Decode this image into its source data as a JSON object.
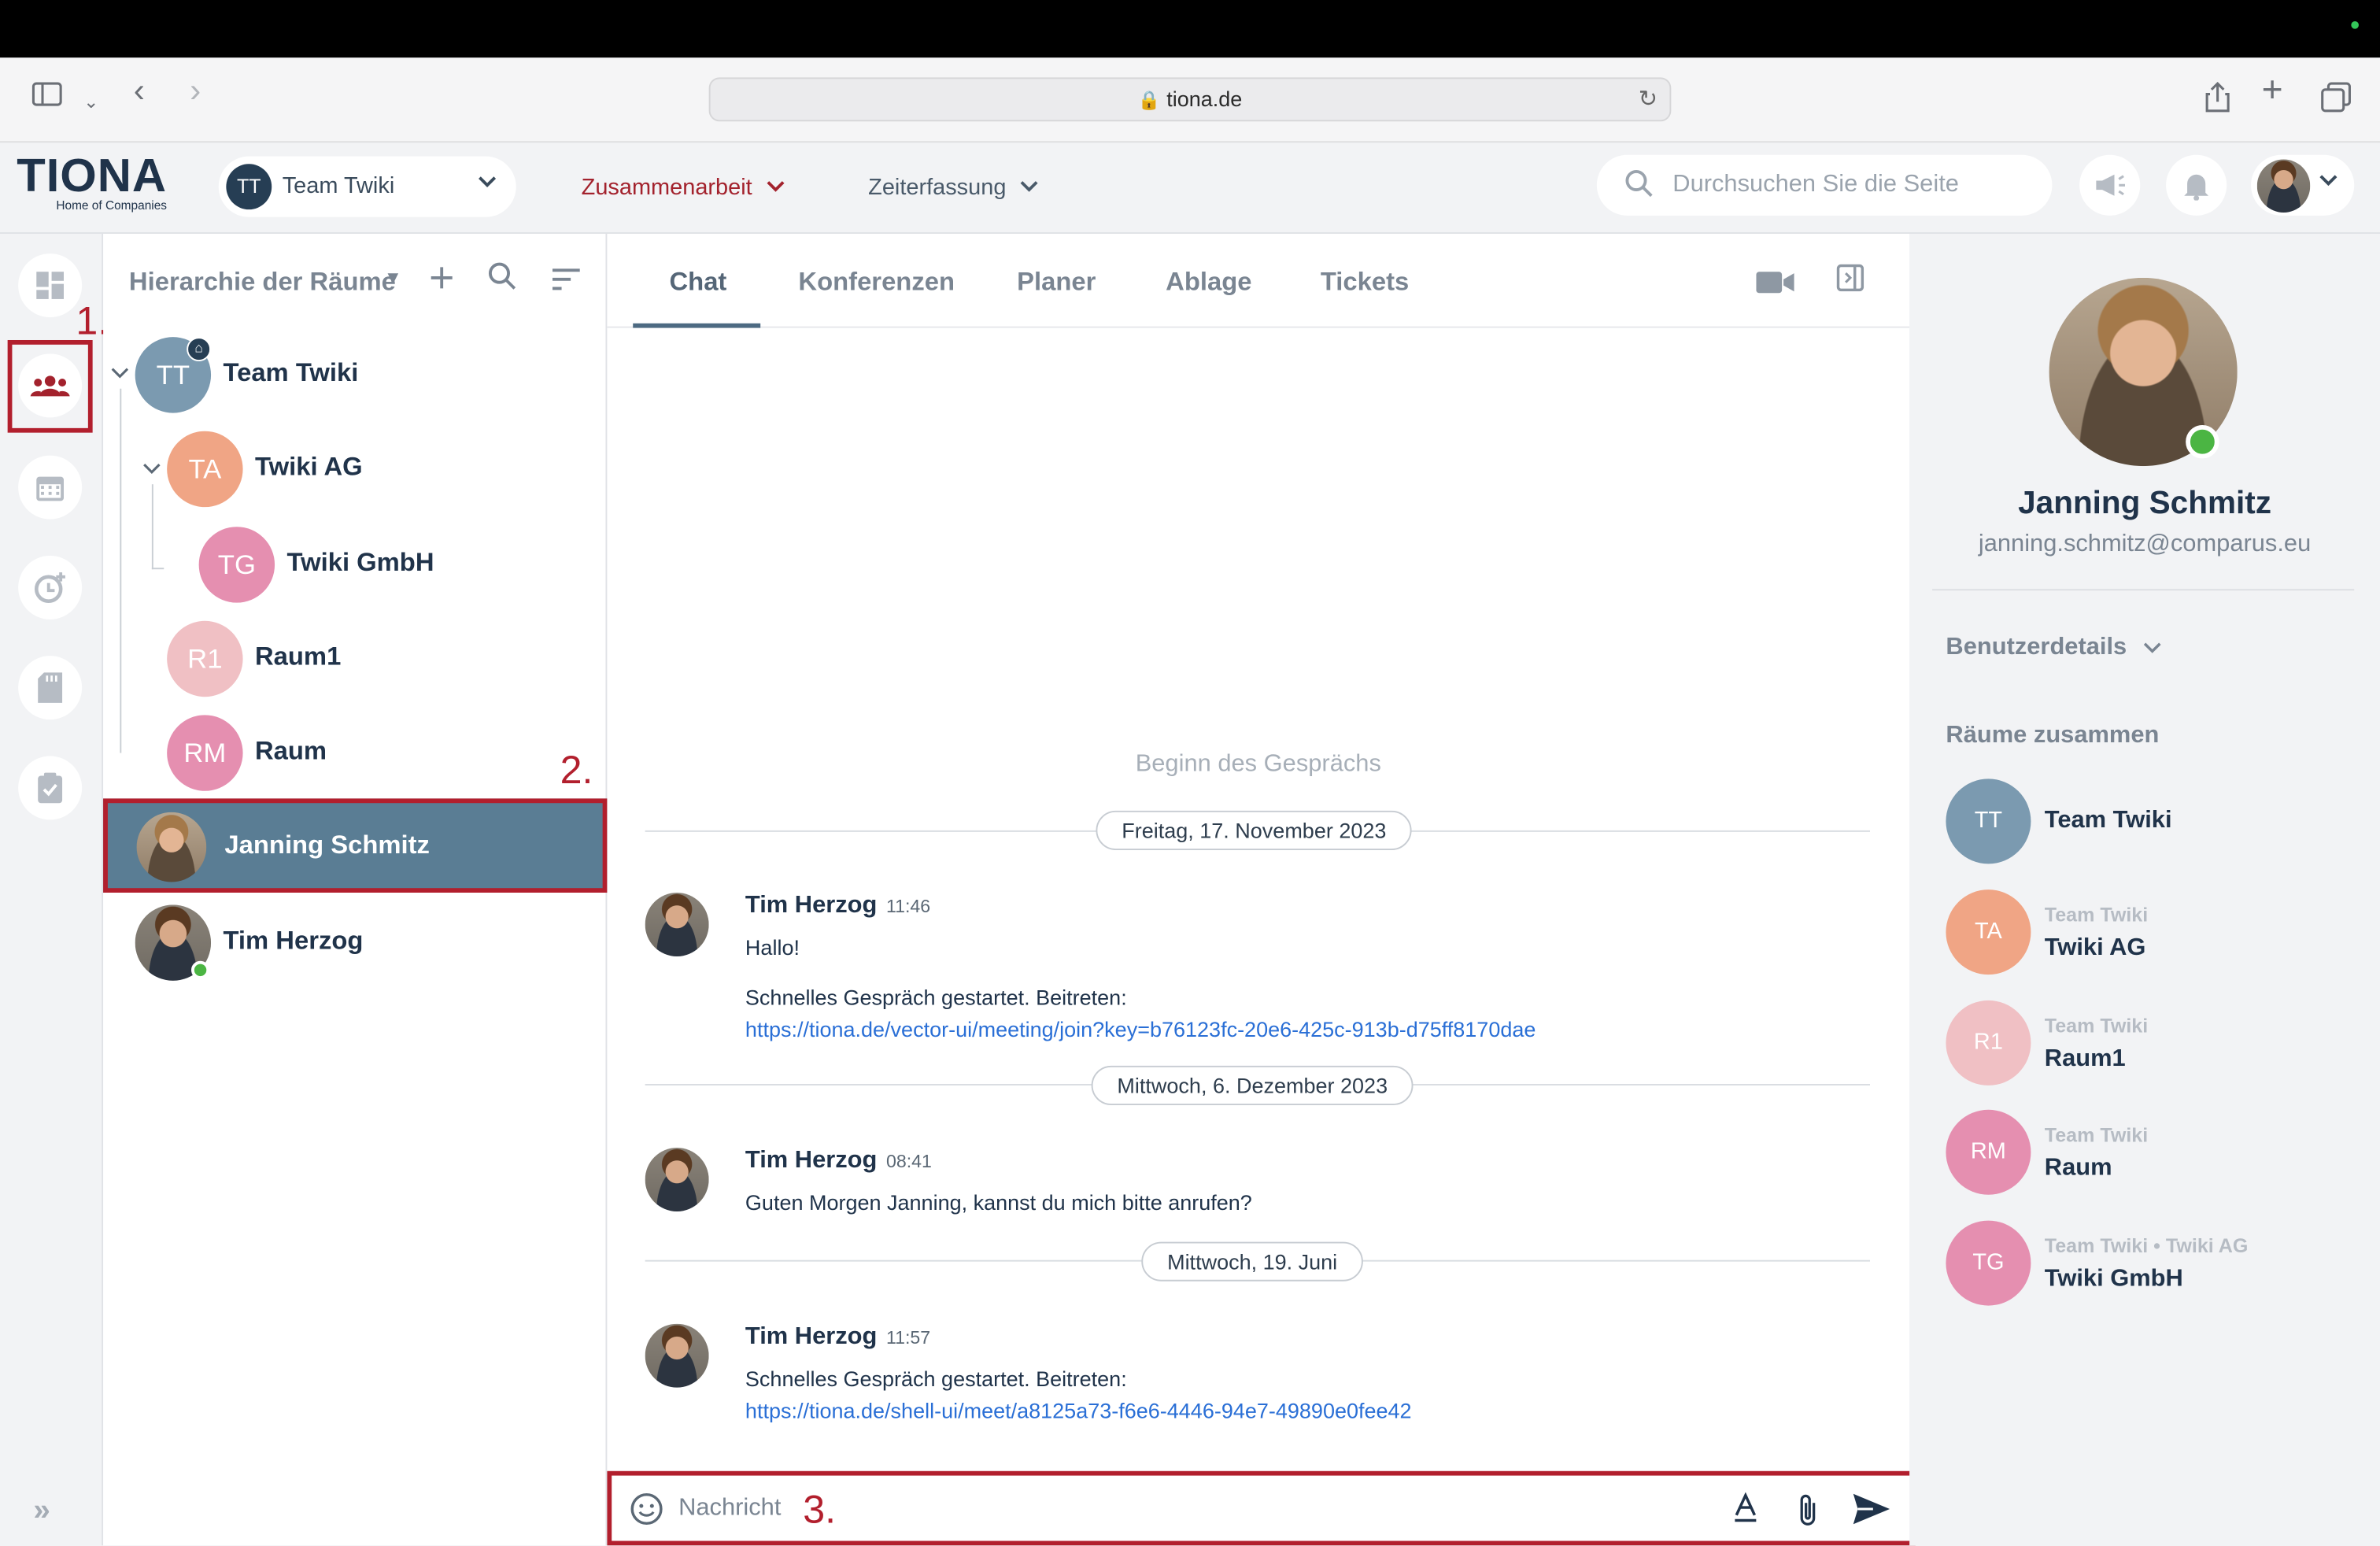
{
  "browser": {
    "url": "tiona.de"
  },
  "header": {
    "logo_text": "TIONA",
    "logo_sub": "Home of Companies",
    "team_selector": {
      "avatar": "TT",
      "label": "Team Twiki"
    },
    "nav": [
      {
        "label": "Zusammenarbeit"
      },
      {
        "label": "Zeiterfassung"
      }
    ],
    "search_placeholder": "Durchsuchen Sie die Seite"
  },
  "colors": {
    "accent_red": "#a3222d",
    "selection_blue": "#5a7d94",
    "navy": "#20334a",
    "online_green": "#4bb543"
  },
  "rail": {
    "step_1": "1.",
    "icons": [
      "dashboard-icon",
      "users-icon",
      "calendar-icon",
      "time-add-icon",
      "storage-icon",
      "task-check-icon"
    ]
  },
  "rooms_panel": {
    "title": "Hierarchie der Räume",
    "step_2": "2.",
    "rooms": [
      {
        "initials": "TT",
        "name": "Team Twiki"
      },
      {
        "initials": "TA",
        "name": "Twiki AG"
      },
      {
        "initials": "TG",
        "name": "Twiki GmbH"
      },
      {
        "initials": "R1",
        "name": "Raum1"
      },
      {
        "initials": "RM",
        "name": "Raum"
      }
    ],
    "direct": [
      {
        "name": "Janning Schmitz"
      },
      {
        "name": "Tim Herzog"
      }
    ]
  },
  "chat": {
    "tabs": [
      "Chat",
      "Konferenzen",
      "Planer",
      "Ablage",
      "Tickets"
    ],
    "begin": "Beginn des Gesprächs",
    "dates": [
      "Freitag, 17. November 2023",
      "Mittwoch, 6. Dezember 2023",
      "Mittwoch, 19. Juni"
    ],
    "messages": [
      {
        "sender": "Tim Herzog",
        "time": "11:46",
        "line1": "Hallo!",
        "line2": "Schnelles Gespräch gestartet. Beitreten:",
        "link": "https://tiona.de/vector-ui/meeting/join?key=b76123fc-20e6-425c-913b-d75ff8170dae"
      },
      {
        "sender": "Tim Herzog",
        "time": "08:41",
        "line1": "Guten Morgen Janning, kannst du mich bitte anrufen?"
      },
      {
        "sender": "Tim Herzog",
        "time": "11:57",
        "line1": "Schnelles Gespräch gestartet. Beitreten:",
        "link": "https://tiona.de/shell-ui/meet/a8125a73-f6e6-4446-94e7-49890e0fee42"
      }
    ],
    "composer_placeholder": "Nachricht",
    "step_3": "3."
  },
  "profile": {
    "name": "Janning Schmitz",
    "email": "janning.schmitz@comparus.eu",
    "details_label": "Benutzerdetails",
    "shared_rooms_label": "Räume zusammen",
    "shared_rooms": [
      {
        "initials": "TT",
        "sub": "",
        "name": "Team Twiki"
      },
      {
        "initials": "TA",
        "sub": "Team Twiki",
        "name": "Twiki AG"
      },
      {
        "initials": "R1",
        "sub": "Team Twiki",
        "name": "Raum1"
      },
      {
        "initials": "RM",
        "sub": "Team Twiki",
        "name": "Raum"
      },
      {
        "initials": "TG",
        "sub": "Team Twiki • Twiki AG",
        "name": "Twiki GmbH"
      }
    ]
  }
}
